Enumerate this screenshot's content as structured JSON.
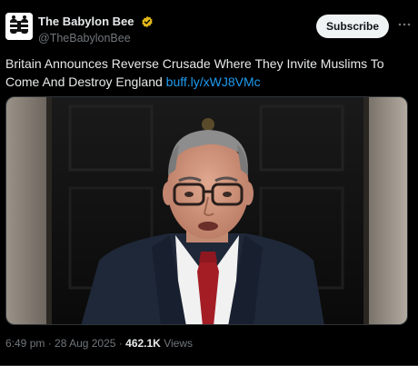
{
  "account": {
    "display_name": "The Babylon Bee",
    "handle": "@TheBabylonBee",
    "avatar_icon": "bee-logo-icon",
    "verified_icon": "verified-gold-badge-icon",
    "verified_color": "#e2b719"
  },
  "actions": {
    "subscribe_label": "Subscribe",
    "more_icon": "more-horizontal-icon"
  },
  "post": {
    "text": "Britain Announces Reverse Crusade Where They Invite Muslims To Come And Destroy England",
    "link": "buff.ly/xWJ8VMc",
    "link_color": "#1d9bf0"
  },
  "meta": {
    "time": "6:49 pm",
    "separator": "·",
    "date": "28 Aug 2025",
    "views_count": "462.1K",
    "views_label": "Views"
  }
}
